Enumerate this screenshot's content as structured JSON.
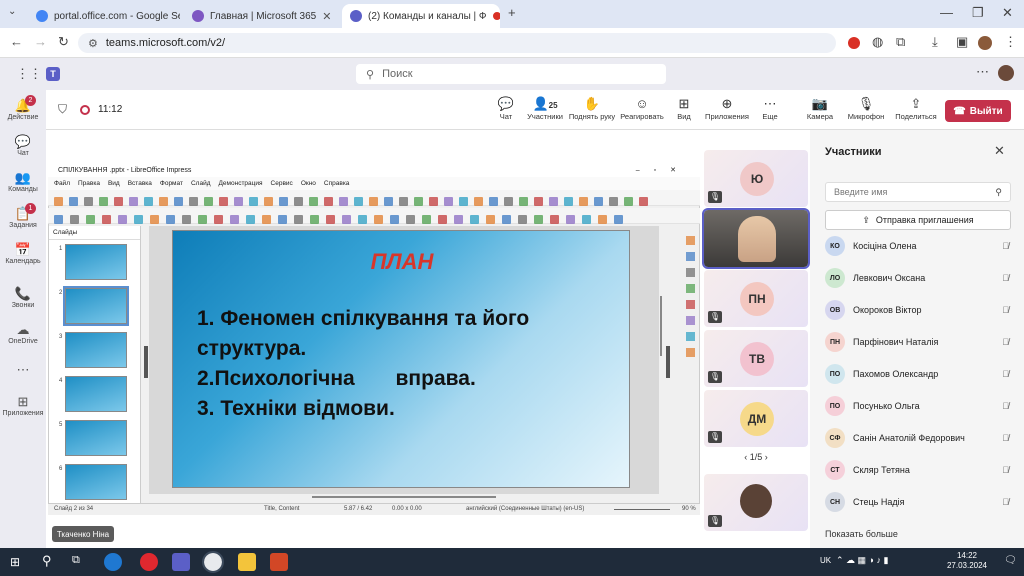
{
  "browser": {
    "tabs": [
      {
        "title": "portal.office.com - Google Sear",
        "color": "#4285f4"
      },
      {
        "title": "Главная | Microsoft 365",
        "color": "#7e57c2"
      },
      {
        "title": "(2) Команды и каналы | Ф",
        "color": "#5b5fc7"
      }
    ],
    "url": "teams.microsoft.com/v2/"
  },
  "teams": {
    "search_placeholder": "Поиск",
    "rail": [
      {
        "label": "Действие",
        "icon": "bell-icon",
        "badge": "2"
      },
      {
        "label": "Чат",
        "icon": "chat-icon",
        "badge": ""
      },
      {
        "label": "Команды",
        "icon": "teams-icon",
        "badge": ""
      },
      {
        "label": "Задания",
        "icon": "assignments-icon",
        "badge": "1"
      },
      {
        "label": "Календарь",
        "icon": "calendar-icon",
        "badge": ""
      },
      {
        "label": "Звонки",
        "icon": "phone-icon",
        "badge": ""
      },
      {
        "label": "OneDrive",
        "icon": "cloud-icon",
        "badge": ""
      },
      {
        "label": "Приложения",
        "icon": "apps-icon",
        "badge": ""
      }
    ],
    "meeting_time": "11:12",
    "toolbar": {
      "chat": "Чат",
      "participants": "Участники",
      "participants_count": "25",
      "raise_hand": "Поднять руку",
      "react": "Реагировать",
      "view": "Вид",
      "apps": "Приложения",
      "more": "Еще",
      "camera": "Камера",
      "mic": "Микрофон",
      "share": "Поделиться",
      "leave": "Выйти"
    }
  },
  "libreoffice": {
    "title": "СПІЛКУВАННЯ .pptx - LibreOffice Impress",
    "menu": [
      "Файл",
      "Правка",
      "Вид",
      "Вставка",
      "Формат",
      "Слайд",
      "Демонстрация",
      "Сервис",
      "Окно",
      "Справка"
    ],
    "slides_label": "Слайды",
    "slide_numbers": [
      "1",
      "2",
      "3",
      "4",
      "5",
      "6"
    ],
    "status": {
      "slide": "Слайд 2 из 34",
      "layout": "Title, Content",
      "pos": "5.87 / 6.42",
      "size": "0.00 x 0.00",
      "lang": "английский (Соединенные Штаты) (en-US)",
      "zoom": "90 %"
    }
  },
  "slide": {
    "title": "ПЛАН",
    "lines": [
      "1. Феномен спілкування та його",
      "структура.",
      "2.Психологічна       вправа.",
      "3. Техніки відмови."
    ]
  },
  "presenter_name": "Ткаченко Ніна",
  "tiles": [
    {
      "initials": "Ю",
      "color": "#f0c8c8"
    },
    {
      "initials": "",
      "color": ""
    },
    {
      "initials": "ПН",
      "color": "#f3c7c0"
    },
    {
      "initials": "ТВ",
      "color": "#f2c2cf"
    },
    {
      "initials": "ДМ",
      "color": "#f6d98a"
    }
  ],
  "pager": "1/5",
  "participants": {
    "title": "Участники",
    "name_placeholder": "Введите имя",
    "invite": "Отправка приглашения",
    "list": [
      {
        "initials": "КО",
        "name": "Косіціна Олена",
        "color": "#c9d8f0"
      },
      {
        "initials": "ЛО",
        "name": "Левкович Оксана",
        "color": "#cde8d0"
      },
      {
        "initials": "ОВ",
        "name": "Окороков Віктор",
        "color": "#d6d6ef"
      },
      {
        "initials": "ПН",
        "name": "Парфінович Наталія",
        "color": "#f5d4cf"
      },
      {
        "initials": "ПО",
        "name": "Пахомов Олександр",
        "color": "#d0e6ee"
      },
      {
        "initials": "ПО",
        "name": "Посунько Ольга",
        "color": "#f5cfd8"
      },
      {
        "initials": "СФ",
        "name": "Санін Анатолій Федорович",
        "color": "#f2dfc4"
      },
      {
        "initials": "СТ",
        "name": "Скляр Тетяна",
        "color": "#f5d0da"
      },
      {
        "initials": "СН",
        "name": "Стець Надія",
        "color": "#d6dbe4"
      }
    ],
    "show_more": "Показать больше"
  },
  "taskbar": {
    "time": "14:22",
    "date": "27.03.2024",
    "lang": "UK"
  }
}
